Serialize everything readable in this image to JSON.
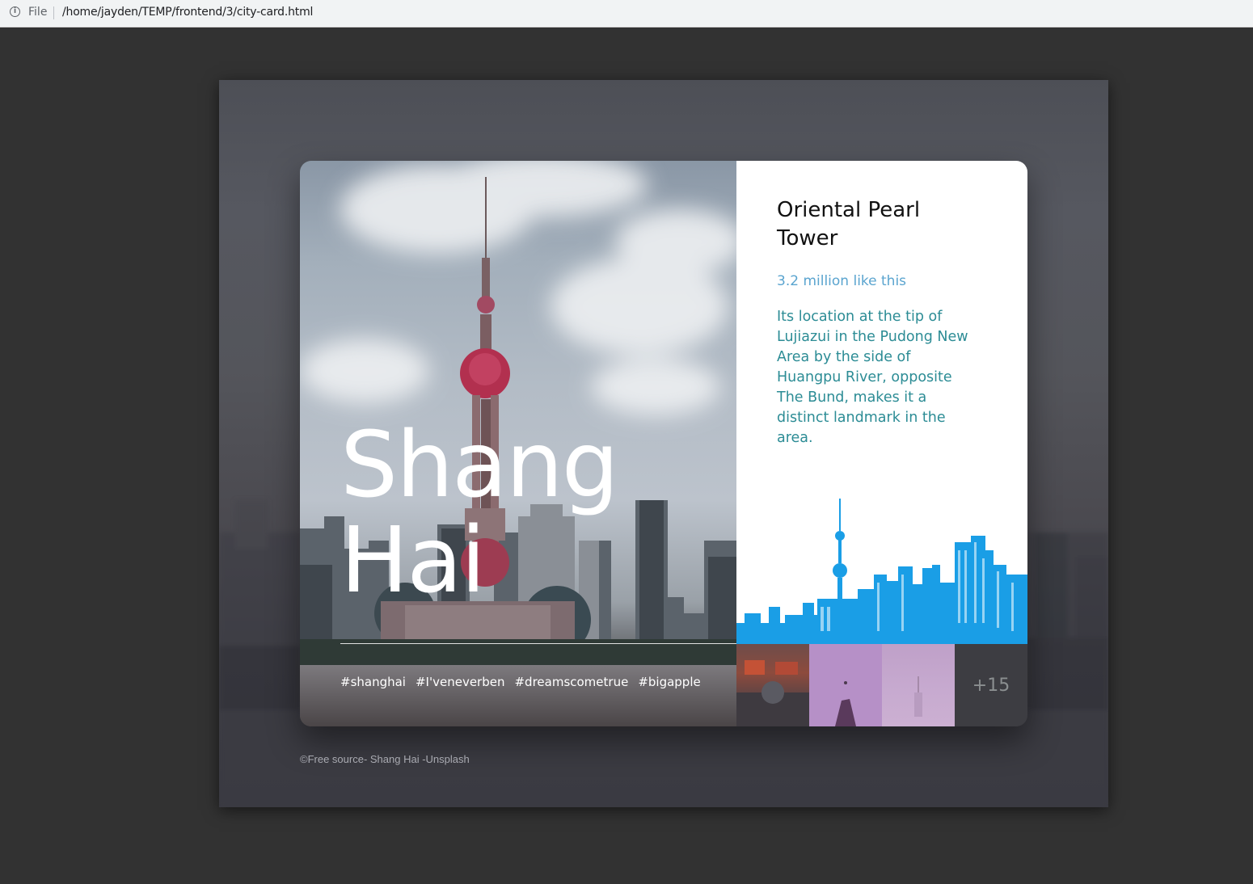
{
  "browser": {
    "scheme_label": "File",
    "url": "/home/jayden/TEMP/frontend/3/city-card.html",
    "info_icon": "info-icon"
  },
  "card": {
    "city_name": "Shang Hai",
    "tags": [
      "#shanghai",
      "#I'veneverben",
      "#dreamscometrue",
      "#bigapple"
    ],
    "landmark": {
      "title": "Oriental Pearl Tower",
      "likes": "3.2 million like this",
      "description": "Its location at the tip of Lujiazui in the Pudong New Area by the side of Huangpu River, opposite The Bund, makes it a distinct landmark in the area."
    },
    "gallery": {
      "more_label": "+15"
    }
  },
  "footer": {
    "credit": "©Free source- Shang Hai -Unsplash"
  },
  "colors": {
    "page_bg": "#323232",
    "likes": "#5aa4cf",
    "description": "#2c8c95",
    "skyline_blue": "#1a9ee6",
    "thumb_purple": "#b690c7"
  }
}
